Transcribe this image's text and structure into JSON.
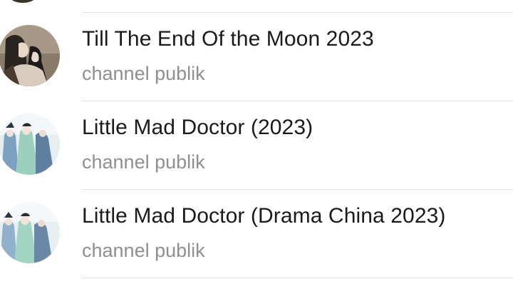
{
  "chats": [
    {
      "title": "Till The End Of the Moon 2023",
      "subtitle": "channel publik",
      "avatar_icon": "drama-poster-avatar",
      "avatar_colors": [
        "#6d5e4e",
        "#c8b9a8",
        "#2b2b2b"
      ]
    },
    {
      "title": "Little Mad Doctor (2023)",
      "subtitle": "channel publik",
      "avatar_icon": "drama-poster-avatar",
      "avatar_colors": [
        "#dfe9ef",
        "#8fc7b8",
        "#6b8fb3"
      ]
    },
    {
      "title": "Little Mad Doctor (Drama China 2023)",
      "subtitle": "channel publik",
      "avatar_icon": "drama-poster-avatar",
      "avatar_colors": [
        "#e4ecef",
        "#8fc7b8",
        "#6b8fb3"
      ]
    }
  ]
}
